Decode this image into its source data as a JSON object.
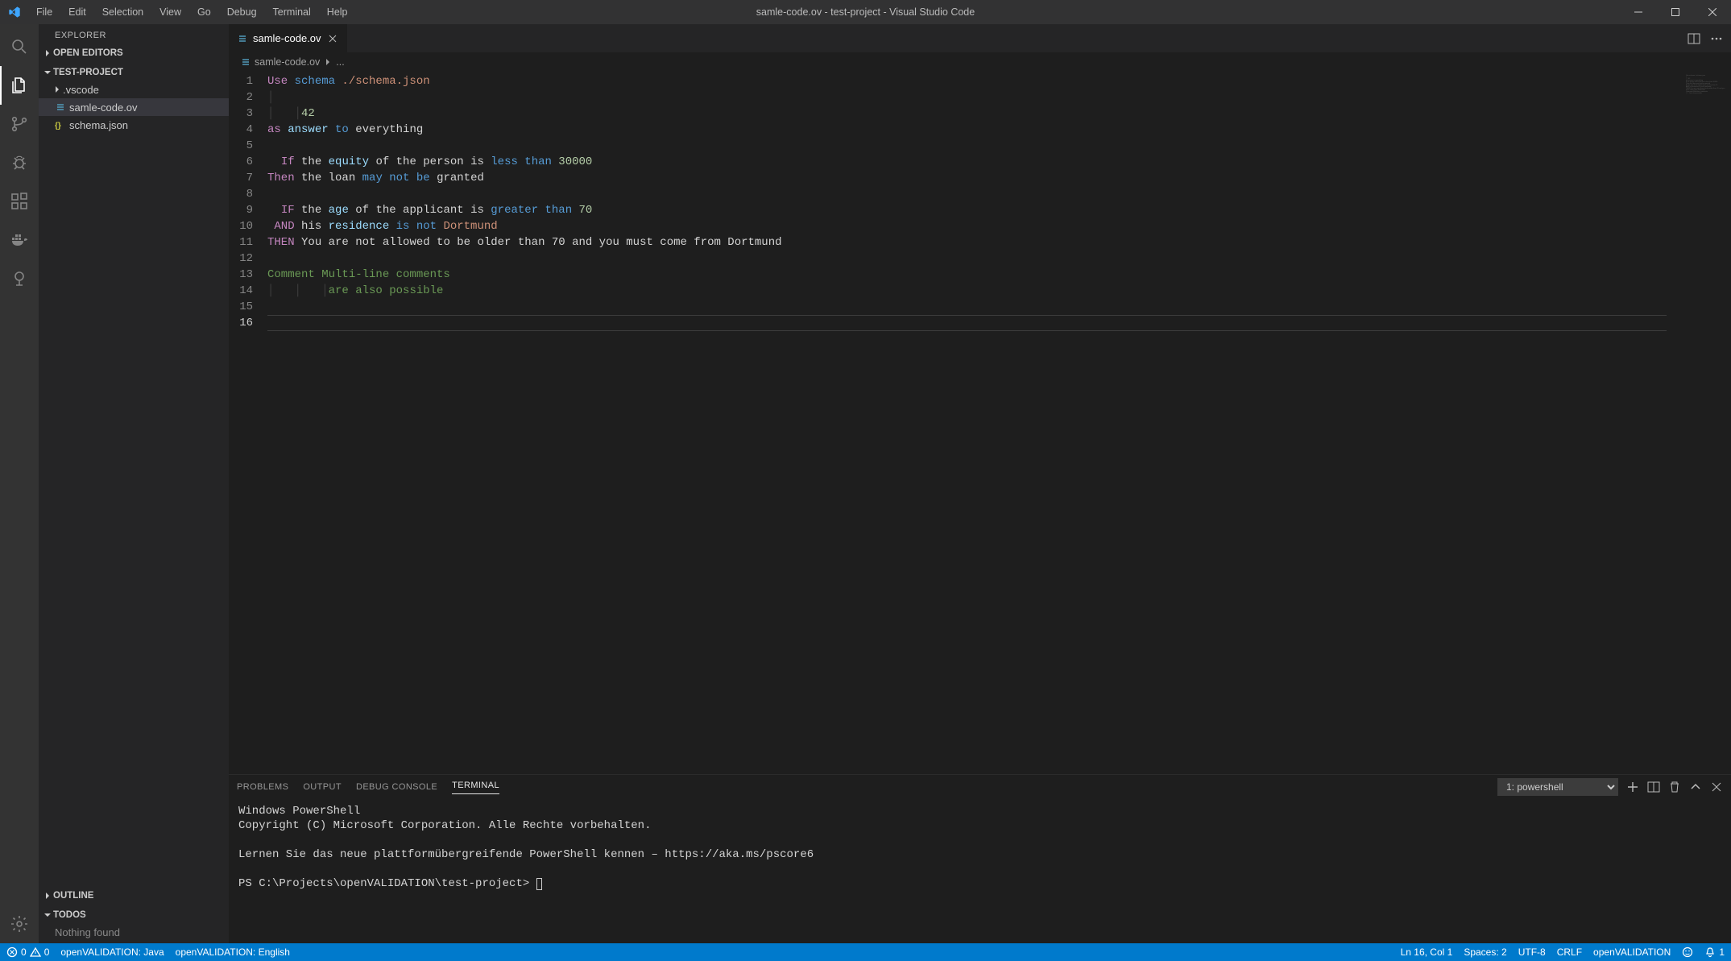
{
  "title": "samle-code.ov - test-project - Visual Studio Code",
  "menu": [
    "File",
    "Edit",
    "Selection",
    "View",
    "Go",
    "Debug",
    "Terminal",
    "Help"
  ],
  "sidebar": {
    "title": "EXPLORER",
    "open_editors": "OPEN EDITORS",
    "project": "TEST-PROJECT",
    "files": {
      "vscode": ".vscode",
      "samle": "samle-code.ov",
      "schema": "schema.json"
    },
    "outline": "OUTLINE",
    "todos": "TODOS",
    "todos_empty": "Nothing found"
  },
  "tab": {
    "label": "samle-code.ov"
  },
  "breadcrumb": {
    "file": "samle-code.ov",
    "rest": "..."
  },
  "editor": {
    "current_line": 16,
    "lines": [
      {
        "n": 1,
        "seg": [
          [
            "tk-kw1",
            "Use "
          ],
          [
            "tk-kw2",
            "schema "
          ],
          [
            "tk-path",
            "./schema.json"
          ]
        ]
      },
      {
        "n": 2,
        "seg": [
          [
            "indent-guide",
            "│   "
          ]
        ]
      },
      {
        "n": 3,
        "seg": [
          [
            "indent-guide",
            "│   │"
          ],
          [
            "tk-num",
            "42"
          ]
        ]
      },
      {
        "n": 4,
        "seg": [
          [
            "tk-kw1",
            "as "
          ],
          [
            "tk-func",
            "answer "
          ],
          [
            "tk-kw2",
            "to "
          ],
          [
            "tk-plain",
            "everything"
          ]
        ]
      },
      {
        "n": 5,
        "seg": []
      },
      {
        "n": 6,
        "seg": [
          [
            "tk-plain",
            "  "
          ],
          [
            "tk-kw1",
            "If "
          ],
          [
            "tk-plain",
            "the "
          ],
          [
            "tk-func",
            "equity "
          ],
          [
            "tk-plain",
            "of the person is "
          ],
          [
            "tk-kw2",
            "less than "
          ],
          [
            "tk-num",
            "30000"
          ]
        ]
      },
      {
        "n": 7,
        "seg": [
          [
            "tk-kw1",
            "Then "
          ],
          [
            "tk-plain",
            "the loan "
          ],
          [
            "tk-kw2",
            "may not be "
          ],
          [
            "tk-plain",
            "granted"
          ]
        ]
      },
      {
        "n": 8,
        "seg": []
      },
      {
        "n": 9,
        "seg": [
          [
            "tk-plain",
            "  "
          ],
          [
            "tk-kw1",
            "IF "
          ],
          [
            "tk-plain",
            "the "
          ],
          [
            "tk-func",
            "age "
          ],
          [
            "tk-plain",
            "of the applicant is "
          ],
          [
            "tk-kw2",
            "greater than "
          ],
          [
            "tk-num",
            "70"
          ]
        ]
      },
      {
        "n": 10,
        "seg": [
          [
            "tk-plain",
            " "
          ],
          [
            "tk-kw1",
            "AND "
          ],
          [
            "tk-plain",
            "his "
          ],
          [
            "tk-func",
            "residence "
          ],
          [
            "tk-kw2",
            "is not "
          ],
          [
            "tk-path",
            "Dortmund"
          ]
        ]
      },
      {
        "n": 11,
        "seg": [
          [
            "tk-kw1",
            "THEN "
          ],
          [
            "tk-plain",
            "You are not allowed to be older than 70 and you must come from Dortmund"
          ]
        ]
      },
      {
        "n": 12,
        "seg": []
      },
      {
        "n": 13,
        "seg": [
          [
            "tk-comm",
            "Comment Multi-line comments"
          ]
        ]
      },
      {
        "n": 14,
        "seg": [
          [
            "indent-guide",
            "│   │   │"
          ],
          [
            "tk-comm",
            "are also possible"
          ]
        ]
      },
      {
        "n": 15,
        "seg": []
      },
      {
        "n": 16,
        "seg": []
      }
    ]
  },
  "panel": {
    "tabs": [
      "PROBLEMS",
      "OUTPUT",
      "DEBUG CONSOLE",
      "TERMINAL"
    ],
    "active_tab": 3,
    "terminal_select": "1: powershell",
    "body": "Windows PowerShell\nCopyright (C) Microsoft Corporation. Alle Rechte vorbehalten.\n\nLernen Sie das neue plattformübergreifende PowerShell kennen – https://aka.ms/pscore6\n\nPS C:\\Projects\\openVALIDATION\\test-project> "
  },
  "status": {
    "errors": "0",
    "warnings": "0",
    "ov_java": "openVALIDATION: Java",
    "ov_lang": "openVALIDATION: English",
    "pos": "Ln 16, Col 1",
    "spaces": "Spaces: 2",
    "encoding": "UTF-8",
    "eol": "CRLF",
    "lang": "openVALIDATION",
    "bell": "1"
  }
}
